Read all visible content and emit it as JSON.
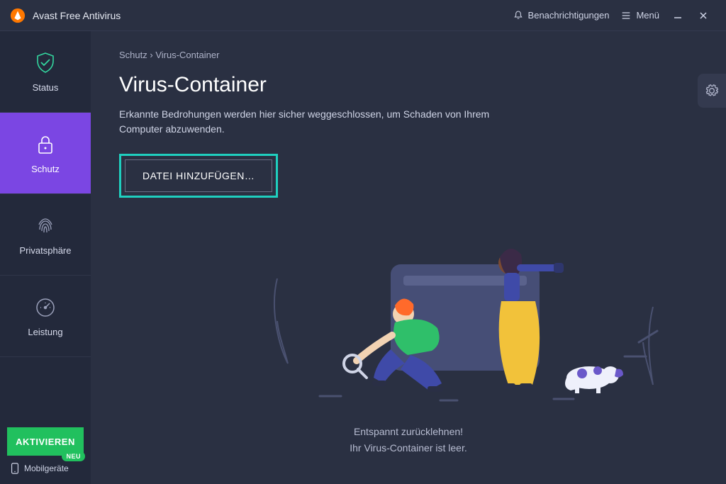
{
  "app": {
    "title": "Avast Free Antivirus"
  },
  "header": {
    "notifications": "Benachrichtigungen",
    "menu": "Menü"
  },
  "sidebar": {
    "items": [
      {
        "label": "Status"
      },
      {
        "label": "Schutz"
      },
      {
        "label": "Privatsphäre"
      },
      {
        "label": "Leistung"
      }
    ],
    "activate": "AKTIVIEREN",
    "mobile": "Mobilgeräte",
    "badge": "NEU"
  },
  "breadcrumb": {
    "root": "Schutz",
    "sep": " › ",
    "leaf": "Virus-Container"
  },
  "page": {
    "title": "Virus-Container",
    "desc": "Erkannte Bedrohungen werden hier sicher weggeschlossen, um Schaden von Ihrem Computer abzuwenden.",
    "add_file": "DATEI HINZUFÜGEN…",
    "empty1": "Entspannt zurücklehnen!",
    "empty2": "Ihr Virus-Container ist leer."
  },
  "colors": {
    "accent": "#7b46e3",
    "highlight": "#1fcfbf",
    "green": "#21c05e",
    "bg": "#2a3042",
    "sidebar": "#23293b"
  }
}
